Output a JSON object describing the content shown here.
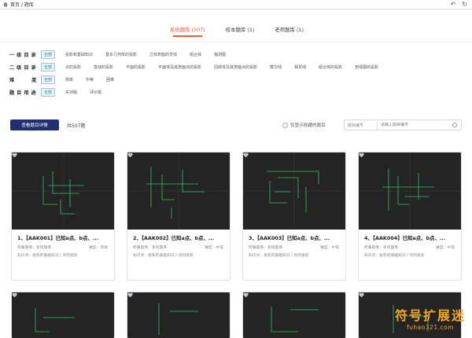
{
  "topbar": {
    "breadcrumb": "首页 / 题库",
    "icons": [
      "home-icon",
      "back-icon",
      "refresh-icon"
    ],
    "back_glyph": "↶",
    "refresh_glyph": "↻"
  },
  "tabs": [
    {
      "label": "系统题库 (507)",
      "active": true
    },
    {
      "label": "校本题库 (1)",
      "active": false
    },
    {
      "label": "老师题库 (1)",
      "active": false
    }
  ],
  "filters": [
    {
      "label": "一级目录",
      "options": [
        "全部",
        "投影和基础知识",
        "基本几何体的投影",
        "立体表面的交线",
        "组合体",
        "轴测图"
      ]
    },
    {
      "label": "二级目录",
      "options": [
        "全部",
        "点的投影",
        "直线的投影",
        "平面的投影",
        "平面体及其表面点的投影",
        "回转体及其表面点的投影",
        "截交线",
        "相贯线",
        "组合体的投影",
        "剖视图的投影"
      ]
    },
    {
      "label": "难度",
      "options": [
        "全部",
        "简单",
        "中等",
        "困难"
      ]
    },
    {
      "label": "题目用途",
      "options": [
        "全部",
        "实训题",
        "评价题"
      ]
    }
  ],
  "toolbar": {
    "primary_button": "查看题目详情",
    "total": "共507题",
    "only_fav": "仅显示收藏的题目",
    "search_select": "题目编号",
    "search_placeholder": "请输入题目编号"
  },
  "cards": [
    {
      "title": "1、【AAK001】已知a点、b点、...",
      "source": "所属题库：系统题库",
      "difficulty": "难度：简单",
      "knowledge": "知识点：投影的基础知识 / 点的投影"
    },
    {
      "title": "2、【AAK002】已知a点、b点、...",
      "source": "所属题库：系统题库",
      "difficulty": "难度：中等",
      "knowledge": "知识点：投影的基础知识 / 点的投影"
    },
    {
      "title": "3、【AAK003】已知a点、b点、...",
      "source": "所属题库：系统题库",
      "difficulty": "难度：中等",
      "knowledge": "知识点：投影的基础知识 / 点的投影"
    },
    {
      "title": "4、【AAK004】已知a点、b点、...",
      "source": "所属题库：系统题库",
      "difficulty": "难度：中等",
      "knowledge": "知识点：投影的基础知识 / 点的投影"
    }
  ],
  "watermark": {
    "cn": "符号扩展迷",
    "en": "fuhao321.com"
  },
  "colors": {
    "accent": "#e25c3b",
    "primary": "#1f2f72",
    "thumb_bg": "#242424",
    "line": "#2fbf6a"
  }
}
